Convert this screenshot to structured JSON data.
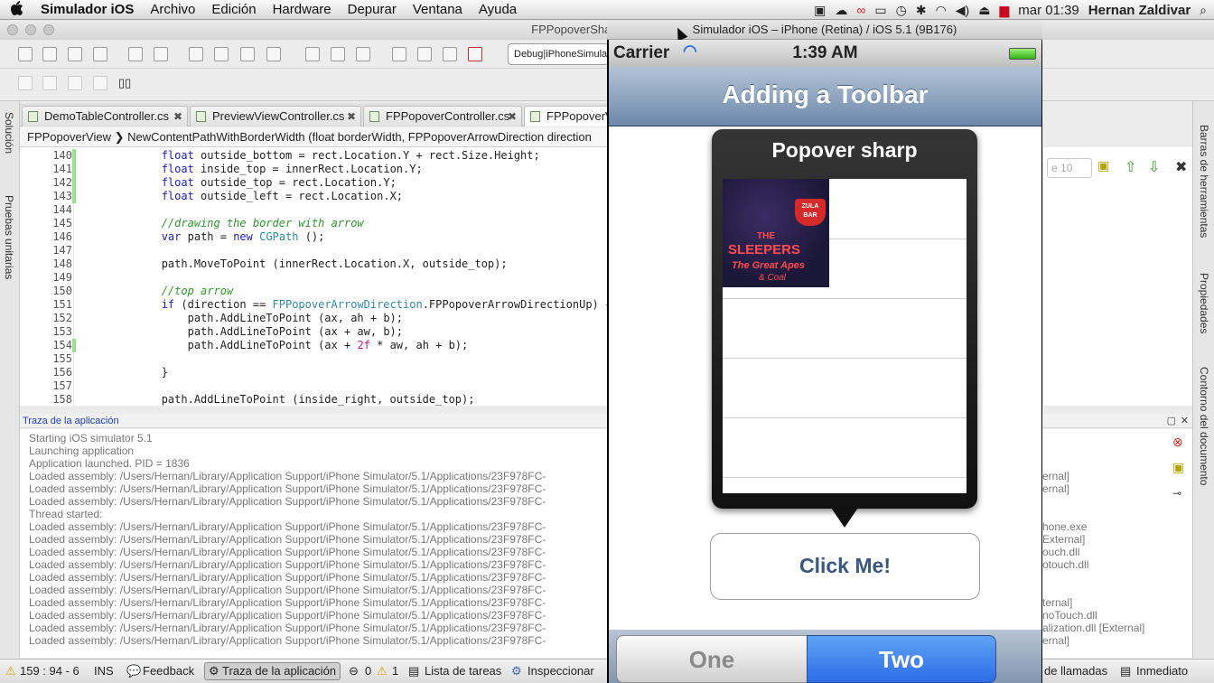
{
  "menubar": {
    "apple": "",
    "app_name": "Simulador iOS",
    "items": [
      "Archivo",
      "Edición",
      "Hardware",
      "Depurar",
      "Ventana",
      "Ayuda"
    ],
    "clock": "mar 01:39",
    "user": "Hernan Zaldivar"
  },
  "ide": {
    "window_title": "FPPopoverSharp – FPPopov",
    "config": "Debug|iPhoneSimulat",
    "tabs": [
      {
        "label": "DemoTableController.cs"
      },
      {
        "label": "PreviewViewController.cs"
      },
      {
        "label": "FPPopoverController.cs"
      },
      {
        "label": "FPPopoverVi"
      }
    ],
    "breadcrumb": {
      "class": "FPPopoverView",
      "method": "NewContentPathWithBorderWidth (float borderWidth, FPPopoverArrowDirection direction"
    },
    "search_placeholder": "e 10",
    "left_pads": [
      "Solución",
      "Pruebas unitarias"
    ],
    "right_pads": [
      "Barras de herramientas",
      "Propiedades",
      "Contorno del documento"
    ],
    "code": [
      {
        "n": "140",
        "t": "            float outside_bottom = rect.Location.Y + rect.Size.Height;"
      },
      {
        "n": "141",
        "t": "            float inside_top = innerRect.Location.Y;"
      },
      {
        "n": "142",
        "t": "            float outside_top = rect.Location.Y;"
      },
      {
        "n": "143",
        "t": "            float outside_left = rect.Location.X;"
      },
      {
        "n": "144",
        "t": ""
      },
      {
        "n": "145",
        "t": "            //drawing the border with arrow"
      },
      {
        "n": "146",
        "t": "            var path = new CGPath ();"
      },
      {
        "n": "147",
        "t": ""
      },
      {
        "n": "148",
        "t": "            path.MoveToPoint (innerRect.Location.X, outside_top);"
      },
      {
        "n": "149",
        "t": ""
      },
      {
        "n": "150",
        "t": "            //top arrow"
      },
      {
        "n": "151",
        "t": "            if (direction == FPPopoverArrowDirection.FPPopoverArrowDirectionUp) {"
      },
      {
        "n": "152",
        "t": "                path.AddLineToPoint (ax, ah + b);"
      },
      {
        "n": "153",
        "t": "                path.AddLineToPoint (ax + aw, b);"
      },
      {
        "n": "154",
        "t": "                path.AddLineToPoint (ax + 2f * aw, ah + b);"
      },
      {
        "n": "155",
        "t": ""
      },
      {
        "n": "156",
        "t": "            }"
      },
      {
        "n": "157",
        "t": ""
      },
      {
        "n": "158",
        "t": "            path.AddLineToPoint (inside_right, outside_top);"
      }
    ],
    "output_title": "Traza de la aplicación",
    "output_lines": [
      "Starting iOS simulator 5.1",
      "Launching application",
      "Application launched. PID = 1836",
      "Loaded assembly: /Users/Hernan/Library/Application Support/iPhone Simulator/5.1/Applications/23F978FC-",
      "Loaded assembly: /Users/Hernan/Library/Application Support/iPhone Simulator/5.1/Applications/23F978FC-",
      "Loaded assembly: /Users/Hernan/Library/Application Support/iPhone Simulator/5.1/Applications/23F978FC-",
      "Thread started:",
      "Loaded assembly: /Users/Hernan/Library/Application Support/iPhone Simulator/5.1/Applications/23F978FC-",
      "Loaded assembly: /Users/Hernan/Library/Application Support/iPhone Simulator/5.1/Applications/23F978FC-",
      "Loaded assembly: /Users/Hernan/Library/Application Support/iPhone Simulator/5.1/Applications/23F978FC-",
      "Loaded assembly: /Users/Hernan/Library/Application Support/iPhone Simulator/5.1/Applications/23F978FC-",
      "Loaded assembly: /Users/Hernan/Library/Application Support/iPhone Simulator/5.1/Applications/23F978FC-",
      "Loaded assembly: /Users/Hernan/Library/Application Support/iPhone Simulator/5.1/Applications/23F978FC-",
      "Loaded assembly: /Users/Hernan/Library/Application Support/iPhone Simulator/5.1/Applications/23F978FC-",
      "Loaded assembly: /Users/Hernan/Library/Application Support/iPhone Simulator/5.1/Applications/23F978FC-",
      "Loaded assembly: /Users/Hernan/Library/Application Support/iPhone Simulator/5.1/Applications/23F978FC-",
      "Loaded assembly: /Users/Hernan/Library/Application Support/iPhone Simulator/5.1/Applications/23F978FC-"
    ],
    "output_right": [
      {
        "row": 3,
        "t": "ernal]"
      },
      {
        "row": 4,
        "t": "ernal]"
      },
      {
        "row": 7,
        "t": "hone.exe"
      },
      {
        "row": 8,
        "t": "External]"
      },
      {
        "row": 9,
        "t": "ouch.dll"
      },
      {
        "row": 10,
        "t": "otouch.dll"
      },
      {
        "row": 13,
        "t": "ternal]"
      },
      {
        "row": 14,
        "t": "noTouch.dll"
      },
      {
        "row": 15,
        "t": "alization.dll [External]"
      },
      {
        "row": 16,
        "t": "ernal]"
      }
    ],
    "status": {
      "position": "159 : 94 - 6",
      "mode": "INS",
      "feedback": "Feedback",
      "trace": "Traza de la aplicación",
      "errors": "0",
      "warnings": "1",
      "tasks": "Lista de tareas",
      "inspect": "Inspeccionar",
      "calls": "de llamadas",
      "immediate": "Inmediato"
    }
  },
  "simulator": {
    "title": "Simulador iOS – iPhone (Retina) / iOS 5.1 (9B176)",
    "carrier": "Carrier",
    "time": "1:39 AM",
    "nav_title": "Adding a Toolbar",
    "popover_title": "Popover sharp",
    "image_text": [
      "ZULA",
      "BAR",
      "THE",
      "SLEEPERS",
      "The Great Apes",
      "& Coal"
    ],
    "button_label": "Click Me!",
    "segments": [
      "One",
      "Two"
    ]
  },
  "colors": {
    "nav_top": "#b3c3d6",
    "nav_bottom": "#6d88ab",
    "segment_selected": "#2d6ce8",
    "button_text": "#3a5782"
  }
}
